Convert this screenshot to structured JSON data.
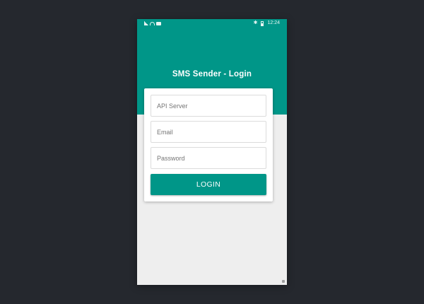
{
  "status_bar": {
    "time": "12:24",
    "left_icons": [
      "signal-icon",
      "wifi-icon",
      "message-icon"
    ],
    "right_icons": [
      "bluetooth-icon",
      "battery-icon"
    ]
  },
  "app": {
    "title": "SMS Sender - Login",
    "header_color": "#009688",
    "background_color": "#eeeeee"
  },
  "form": {
    "api_server_placeholder": "API Server",
    "email_placeholder": "Email",
    "password_placeholder": "Password",
    "api_server_value": "",
    "email_value": "",
    "password_value": "",
    "login_label": "LOGIN"
  },
  "desktop_background": "#25282e"
}
